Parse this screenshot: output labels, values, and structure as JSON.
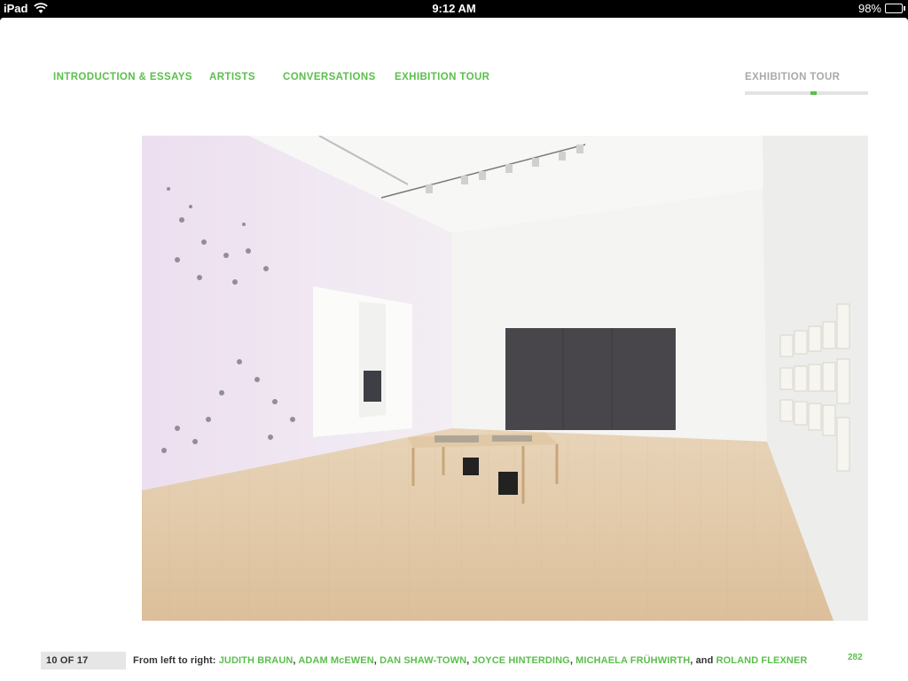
{
  "status_bar": {
    "device": "iPad",
    "time": "9:12 AM",
    "battery": "98%",
    "battery_level": 0.98
  },
  "nav": {
    "items": [
      {
        "label": "INTRODUCTION & ESSAYS"
      },
      {
        "label": "ARTISTS"
      },
      {
        "label": "CONVERSATIONS"
      },
      {
        "label": "EXHIBITION TOUR"
      }
    ]
  },
  "section_indicator": {
    "label": "EXHIBITION TOUR",
    "position": 10,
    "total": 17
  },
  "photo": {
    "description_icon": "gallery-installation-photo"
  },
  "footer": {
    "counter": "10 OF 17",
    "caption_prefix": "From left to right: ",
    "artists": [
      "JUDITH BRAUN",
      "ADAM McEWEN",
      "DAN SHAW-TOWN",
      "JOYCE HINTERDING",
      "MICHAELA FRÜHWIRTH",
      "ROLAND FLEXNER"
    ],
    "separator": ", ",
    "final_separator": ", and ",
    "page_number": "282"
  },
  "colors": {
    "accent": "#5bbf4c",
    "muted": "#a9a9a9"
  }
}
